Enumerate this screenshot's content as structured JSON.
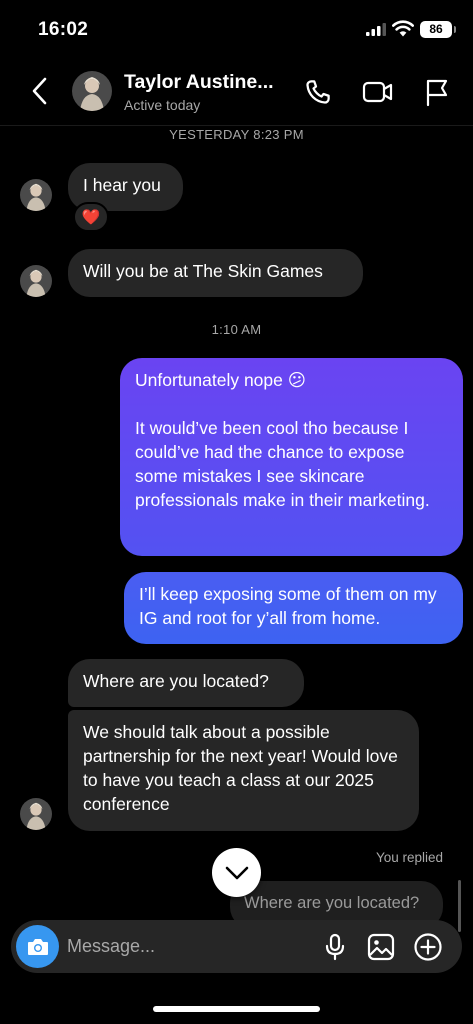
{
  "status_bar": {
    "time": "16:02",
    "battery": "86"
  },
  "header": {
    "name": "Taylor Austine...",
    "status": "Active today"
  },
  "messages": {
    "timestamp_1": "YESTERDAY 8:23 PM",
    "in_1": "I hear you",
    "in_1_reaction": "❤️",
    "in_2": "Will you be at The Skin Games",
    "timestamp_2": "1:10 AM",
    "out_1_line1": "Unfortunately nope 😕",
    "out_1_body": "It would’ve been cool tho because I could’ve had the chance to expose some mistakes I see skincare professionals make in their marketing.",
    "out_2": "I’ll keep exposing some of them on my IG and root for y’all from home.",
    "in_3": "Where are you located?",
    "in_4": "We should talk about a possible partnership for the next year! Would love to have you teach a class at our 2025 conference",
    "replied_label": "You replied",
    "reply_quote": "Where are you located?"
  },
  "composer": {
    "placeholder": "Message..."
  },
  "colors": {
    "out_grad_top": "#6a44f2",
    "out_grad_bottom": "#3d63f2",
    "incoming": "#262626",
    "accent": "#3797f0"
  }
}
